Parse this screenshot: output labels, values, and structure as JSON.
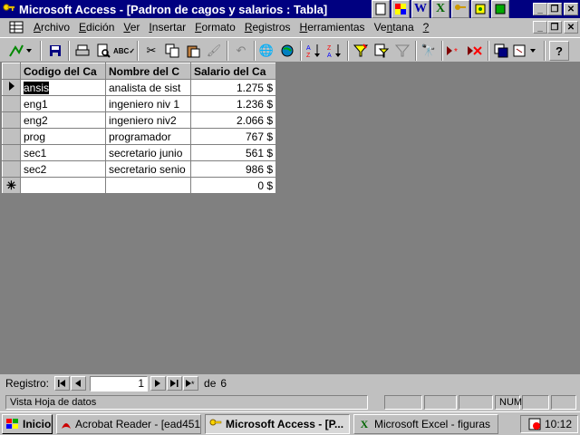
{
  "window": {
    "title": "Microsoft Access - [Padron de cagos y salarios : Tabla]"
  },
  "menu": {
    "items": [
      {
        "label": "Archivo",
        "u": "A"
      },
      {
        "label": "Edición",
        "u": "E"
      },
      {
        "label": "Ver",
        "u": "V"
      },
      {
        "label": "Insertar",
        "u": "I"
      },
      {
        "label": "Formato",
        "u": "F"
      },
      {
        "label": "Registros",
        "u": "R"
      },
      {
        "label": "Herramientas",
        "u": "H"
      },
      {
        "label": "Ventana",
        "u": "n"
      },
      {
        "label": "?",
        "u": "?"
      }
    ]
  },
  "table": {
    "headers": [
      "Codigo del Ca",
      "Nombre del C",
      "Salario del Ca"
    ],
    "rows": [
      {
        "codigo": "ansis",
        "nombre": "analista de sist",
        "salario": "1.275 $"
      },
      {
        "codigo": "eng1",
        "nombre": "ingeniero niv 1",
        "salario": "1.236 $"
      },
      {
        "codigo": "eng2",
        "nombre": "ingeniero niv2",
        "salario": "2.066 $"
      },
      {
        "codigo": "prog",
        "nombre": "programador",
        "salario": "767 $"
      },
      {
        "codigo": "sec1",
        "nombre": "secretario junio",
        "salario": "561 $"
      },
      {
        "codigo": "sec2",
        "nombre": "secretario senio",
        "salario": "986 $"
      }
    ],
    "new_row_salario": "0 $"
  },
  "navigation": {
    "label": "Registro:",
    "current": "1",
    "of_label": "de",
    "total": "6"
  },
  "status": {
    "text": "Vista Hoja de datos",
    "num": "NUM"
  },
  "taskbar": {
    "start": "Inicio",
    "tasks": [
      "Acrobat Reader - [ead451-...",
      "Microsoft Access - [P...",
      "Microsoft Excel - figuras"
    ],
    "time": "10:12"
  }
}
